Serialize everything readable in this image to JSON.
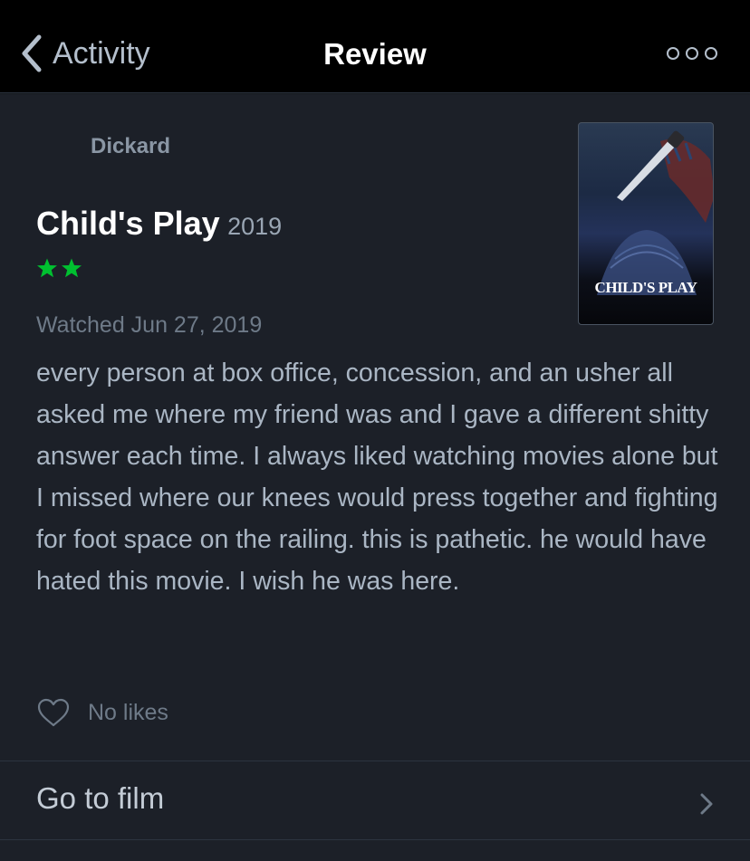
{
  "nav": {
    "back_label": "Activity",
    "title": "Review",
    "more_icon": "ellipsis-icon"
  },
  "review": {
    "reviewer": "Dickard",
    "film_title": "Child's Play",
    "year": "2019",
    "rating_stars": 2,
    "rating_max": 5,
    "star_color": "#00c030",
    "watched": "Watched Jun 27, 2019",
    "text": "every person at box office, concession, and an usher all asked me where my friend was and I gave a different shitty answer each time. I always liked watching movies alone but I missed where our knees would press together and fighting for foot space on the railing. this is pathetic. he would have hated this movie. I wish he was here."
  },
  "poster": {
    "title": "CHILD'S PLAY"
  },
  "likes": {
    "label": "No likes",
    "icon": "heart-icon"
  },
  "actions": {
    "go_to_film": "Go to film"
  },
  "colors": {
    "navbar": "#000000",
    "background": "#1c2028",
    "accent_green": "#00c030"
  }
}
